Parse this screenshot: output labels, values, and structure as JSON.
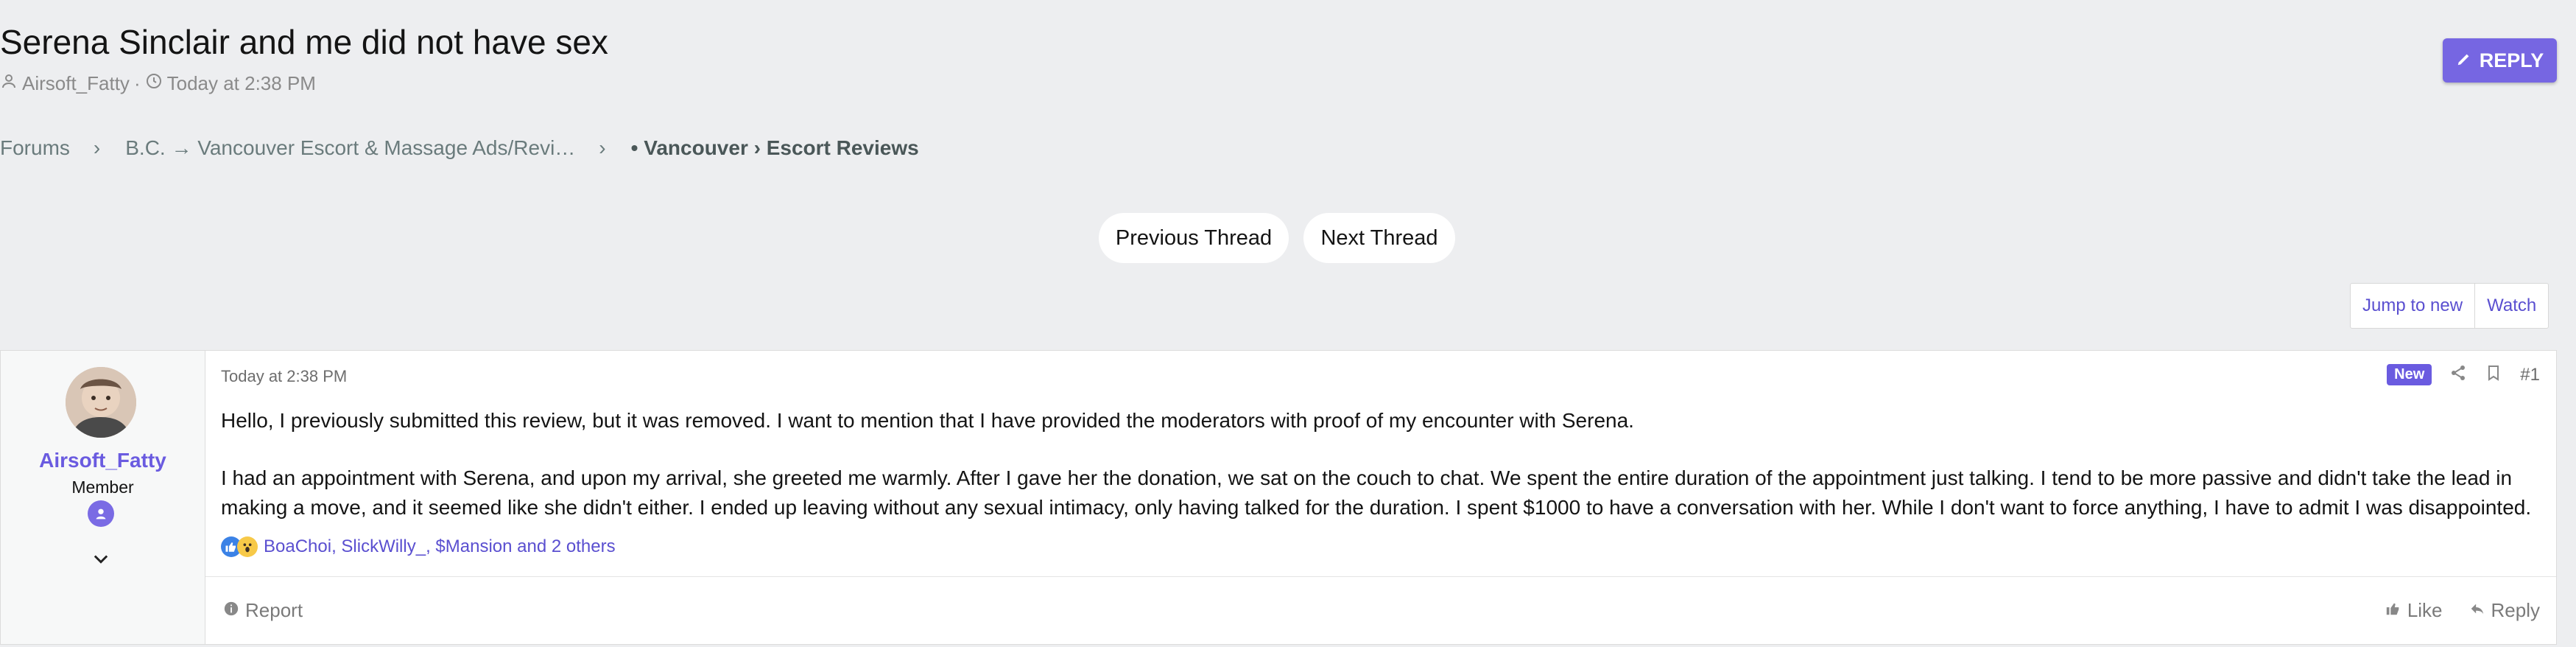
{
  "thread": {
    "title": "Serena Sinclair and me did not have sex",
    "author": "Airsoft_Fatty",
    "separator": "·",
    "date": "Today at 2:38 PM"
  },
  "reply_button": {
    "label": "REPLY",
    "icon": "pencil-icon"
  },
  "breadcrumbs": {
    "items": [
      "Forums",
      "B.C. → Vancouver Escort & Massage Ads/Revi…"
    ],
    "current": "• Vancouver › Escort Reviews"
  },
  "thread_nav": {
    "prev": "Previous Thread",
    "next": "Next Thread"
  },
  "watch_bar": {
    "jump": "Jump to new",
    "watch": "Watch"
  },
  "post": {
    "user": {
      "name": "Airsoft_Fatty",
      "title": "Member"
    },
    "date": "Today at 2:38 PM",
    "new_badge": "New",
    "number": "#1",
    "paragraphs": [
      "Hello, I previously submitted this review, but it was removed. I want to mention that I have provided the moderators with proof of my encounter with Serena.",
      "I had an appointment with Serena, and upon my arrival, she greeted me warmly. After I gave her the donation, we sat on the couch to chat. We spent the entire duration of the appointment just talking. I tend to be more passive and didn't take the lead in making a move, and it seemed like she didn't either. I ended up leaving without any sexual intimacy, only having talked for the duration. I spent $1000 to have a conversation with her. While I don't want to force anything, I have to admit I was disappointed."
    ],
    "reactions_text": "BoaChoi, SlickWilly_, $Mansion and 2 others",
    "footer": {
      "report": "Report",
      "like": "Like",
      "reply": "Reply"
    }
  },
  "colors": {
    "accent": "#7666e2",
    "link": "#5a4fd0",
    "background": "#edeef0"
  }
}
